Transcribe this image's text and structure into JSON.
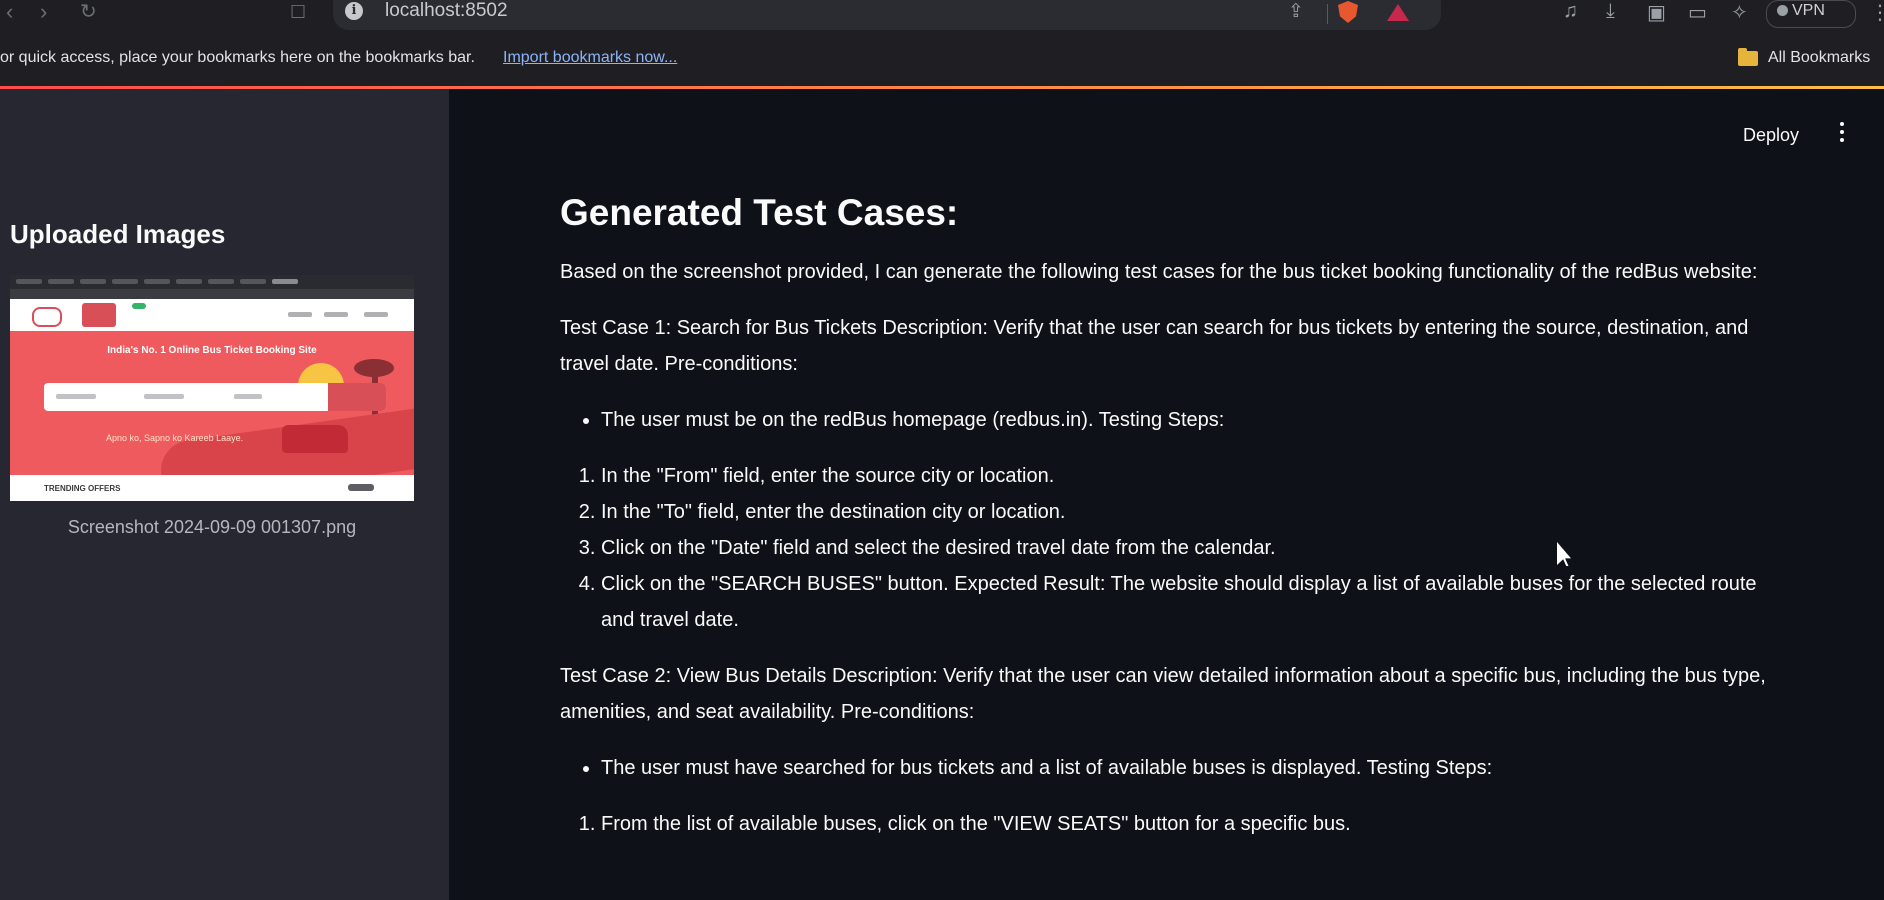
{
  "browser": {
    "url": "localhost:8502",
    "vpn_label": "VPN"
  },
  "bookmarks_bar": {
    "hint": "or quick access, place your bookmarks here on the bookmarks bar.",
    "import_link": "Import bookmarks now...",
    "all_bookmarks": "All Bookmarks"
  },
  "accent_gradient": [
    "#ff4b4b",
    "#ffbd45"
  ],
  "sidebar": {
    "title": "Uploaded Images",
    "image": {
      "caption": "Screenshot 2024-09-09 001307.png",
      "headline": "India's No. 1 Online Bus Ticket Booking Site",
      "tagline": "Apno ko, Sapno ko Kareeb Laaye.",
      "offers_label": "TRENDING OFFERS"
    }
  },
  "header": {
    "deploy_label": "Deploy"
  },
  "main": {
    "heading": "Generated Test Cases:",
    "intro": "Based on the screenshot provided, I can generate the following test cases for the bus ticket booking functionality of the redBus website:",
    "tc1": {
      "summary": "Test Case 1: Search for Bus Tickets Description: Verify that the user can search for bus tickets by entering the source, destination, and travel date. Pre-conditions:",
      "precondition": "The user must be on the redBus homepage (redbus.in). Testing Steps:",
      "steps": [
        "In the \"From\" field, enter the source city or location.",
        "In the \"To\" field, enter the destination city or location.",
        "Click on the \"Date\" field and select the desired travel date from the calendar.",
        "Click on the \"SEARCH BUSES\" button. Expected Result: The website should display a list of available buses for the selected route and travel date."
      ]
    },
    "tc2": {
      "summary": "Test Case 2: View Bus Details Description: Verify that the user can view detailed information about a specific bus, including the bus type, amenities, and seat availability. Pre-conditions:",
      "precondition": "The user must have searched for bus tickets and a list of available buses is displayed. Testing Steps:",
      "steps": [
        "From the list of available buses, click on the \"VIEW SEATS\" button for a specific bus."
      ]
    }
  }
}
